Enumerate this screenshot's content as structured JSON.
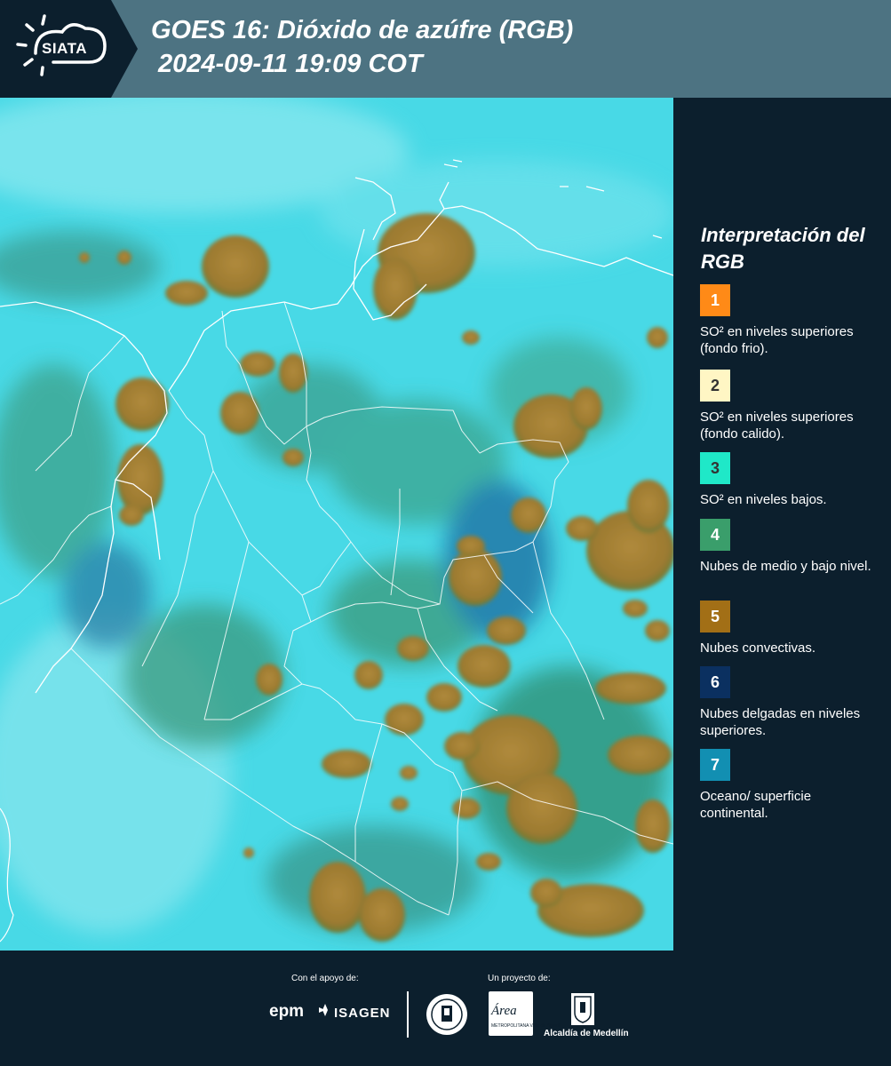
{
  "header": {
    "logo_text": "SIATA",
    "title": "GOES 16: Dióxido de azúfre (RGB)",
    "timestamp": "2024-09-11 19:09 COT"
  },
  "colors": {
    "header_bg": "#4d7382",
    "panel_bg": "#0c1f2d",
    "map_base": "#3fd6e4",
    "convective": "#a27a2e",
    "green_mid": "#3a9870"
  },
  "legend": {
    "title": "Interpretación del RGB",
    "items": [
      {
        "number": "1",
        "color": "#ff8a17",
        "label": "SO² en niveles superiores (fondo frio)."
      },
      {
        "number": "2",
        "color": "#fff6c4",
        "label": "SO² en niveles superiores (fondo calido)."
      },
      {
        "number": "3",
        "color": "#1fe8c8",
        "label": "SO² en niveles bajos."
      },
      {
        "number": "4",
        "color": "#3a9e6b",
        "label": "Nubes de medio y bajo nivel."
      },
      {
        "number": "5",
        "color": "#a26f16",
        "label": "Nubes convectivas."
      },
      {
        "number": "6",
        "color": "#0b3060",
        "label": "Nubes delgadas en niveles superiores."
      },
      {
        "number": "7",
        "color": "#128fb2",
        "label": "Oceano/ superficie continental."
      }
    ]
  },
  "footer": {
    "support_label": "Con el apoyo de:",
    "project_label": "Un proyecto de:",
    "epm": "epm",
    "isagen": "ISAGEN",
    "area_name": "Área",
    "area_sub": "METROPOLITANA Valle de Aburrá",
    "alcaldia": "Alcaldía de Medellín"
  }
}
